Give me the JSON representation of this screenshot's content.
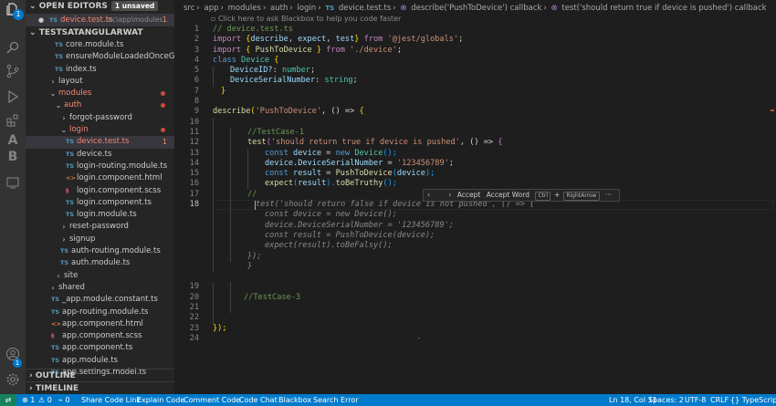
{
  "activity_bar": {
    "items": [
      "files-icon",
      "search-icon",
      "source-control-icon",
      "run-debug-icon",
      "extensions-icon",
      "azure-icon",
      "blackbox-icon",
      "remote-explorer-icon"
    ],
    "badge": "1",
    "accounts_badge": "1",
    "azure_letter": "A",
    "blackbox_letter": "B"
  },
  "sidebar": {
    "open_editors_title": "OPEN EDITORS",
    "unsaved_label": "1 unsaved",
    "open_file_name": "device.test.ts",
    "open_file_path": "src\\app\\modules...",
    "open_file_count": "1",
    "project_title": "TESTSATANGULARWAT",
    "tree": [
      {
        "label": "core.module.ts",
        "icon": "TS"
      },
      {
        "label": "ensureModuleLoadedOnceGuard.ts",
        "icon": "TS"
      },
      {
        "label": "index.ts",
        "icon": "TS"
      },
      {
        "label": "layout",
        "icon": ""
      },
      {
        "label": "modules",
        "icon": ""
      },
      {
        "label": "auth",
        "icon": ""
      },
      {
        "label": "forgot-password",
        "icon": ""
      },
      {
        "label": "login",
        "icon": ""
      },
      {
        "label": "device.test.ts",
        "icon": "TS",
        "count": "1"
      },
      {
        "label": "device.ts",
        "icon": "TS"
      },
      {
        "label": "login-routing.module.ts",
        "icon": "TS"
      },
      {
        "label": "login.component.html",
        "icon": "<>"
      },
      {
        "label": "login.component.scss",
        "icon": "§"
      },
      {
        "label": "login.component.ts",
        "icon": "TS"
      },
      {
        "label": "login.module.ts",
        "icon": "TS"
      },
      {
        "label": "reset-password",
        "icon": ""
      },
      {
        "label": "signup",
        "icon": ""
      },
      {
        "label": "auth-routing.module.ts",
        "icon": "TS"
      },
      {
        "label": "auth.module.ts",
        "icon": "TS"
      },
      {
        "label": "site",
        "icon": ""
      },
      {
        "label": "shared",
        "icon": ""
      },
      {
        "label": "_app.module.constant.ts",
        "icon": "TS"
      },
      {
        "label": "app-routing.module.ts",
        "icon": "TS"
      },
      {
        "label": "app.component.html",
        "icon": "<>"
      },
      {
        "label": "app.component.scss",
        "icon": "§"
      },
      {
        "label": "app.component.ts",
        "icon": "TS"
      },
      {
        "label": "app.module.ts",
        "icon": "TS"
      },
      {
        "label": "app.settings.model.ts",
        "icon": "TS"
      }
    ],
    "outline_title": "OUTLINE",
    "timeline_title": "TIMELINE"
  },
  "breadcrumb": {
    "segments": [
      "src",
      "app",
      "modules",
      "auth",
      "login"
    ],
    "file_icon": "TS",
    "file": "device.test.ts",
    "symbol1": "describe('PushToDevice') callback",
    "symbol2": "test('should return true if device is pushed') callback"
  },
  "hint": "Click here to ask Blackbox to help you code faster",
  "code": {
    "line_numbers": [
      "1",
      "2",
      "3",
      "4",
      "5",
      "6",
      "7",
      "8",
      "9",
      "10",
      "11",
      "12",
      "13",
      "14",
      "15",
      "16",
      "17",
      "18",
      "",
      "",
      "",
      "",
      "",
      "",
      "19",
      "20",
      "21",
      "22",
      "23",
      "24"
    ],
    "l1": "// device.test.ts",
    "l2_a": "import ",
    "l2_b": "{",
    "l2_c": "describe",
    "l2_d": ", ",
    "l2_e": "expect",
    "l2_f": ", ",
    "l2_g": "test",
    "l2_h": "}",
    "l2_i": " from ",
    "l2_j": "'@jest/globals'",
    "l2_k": ";",
    "l3_a": "import ",
    "l3_b": "{ ",
    "l3_c": "PushToDevice",
    "l3_d": " }",
    "l3_e": " from ",
    "l3_f": "'./device'",
    "l3_g": ";",
    "l4_a": "class ",
    "l4_b": "Device",
    "l4_c": " {",
    "l5_a": "DeviceID?",
    "l5_b": ": ",
    "l5_c": "number",
    "l5_d": ";",
    "l6_a": "DeviceSerialNumber",
    "l6_b": ": ",
    "l6_c": "string",
    "l6_d": ";",
    "l7": "}",
    "l9_a": "describe",
    "l9_b": "(",
    "l9_c": "'PushToDevice'",
    "l9_d": ", () => ",
    "l9_e": "{",
    "l11": "//TestCase-1",
    "l12_a": "test",
    "l12_b": "(",
    "l12_c": "'should return true if device is pushed'",
    "l12_d": ", () => ",
    "l12_e": "{",
    "l13_a": "const ",
    "l13_b": "device",
    "l13_c": " = ",
    "l13_d": "new ",
    "l13_e": "Device",
    "l13_f": "();",
    "l14_a": "device",
    "l14_b": ".",
    "l14_c": "DeviceSerialNumber",
    "l14_d": " = ",
    "l14_e": "'123456789'",
    "l14_f": ";",
    "l15_a": "const ",
    "l15_b": "result",
    "l15_c": " = ",
    "l15_d": "PushToDevice",
    "l15_e": "(",
    "l15_f": "device",
    "l15_g": ");",
    "l16_a": "expect",
    "l16_b": "(",
    "l16_c": "result",
    "l16_d": ").",
    "l16_e": "toBeTruthy",
    "l16_f": "();",
    "l17": "//",
    "ghost1": "test('should return false if device is not pushed', () => {",
    "ghost2": "const device = new Device();",
    "ghost3": "device.DeviceSerialNumber = '123456789';",
    "ghost4": "const result = PushToDevice(device);",
    "ghost5": "expect(result).toBeFalsy();",
    "ghost6": "});",
    "ghost7": "}",
    "l20": "//TestCase-3",
    "l23": "});"
  },
  "inline_toolbar": {
    "prev": "‹",
    "next": "›",
    "accept": "Accept",
    "accept_word": "Accept Word",
    "key1": "Ctrl",
    "plus": "+",
    "key2": "RightArrow",
    "more": "···"
  },
  "statusbar": {
    "remote": "⇄",
    "errors": "1",
    "warnings": "0",
    "ports": "0",
    "items": [
      "Share Code Link",
      "Explain Code",
      "Comment Code",
      "Code Chat",
      "Blackbox",
      "Search Error"
    ],
    "position": "Ln 18, Col 11",
    "spaces": "Spaces: 2",
    "encoding": "UTF-8",
    "eol": "CRLF",
    "language": "TypeScript"
  }
}
